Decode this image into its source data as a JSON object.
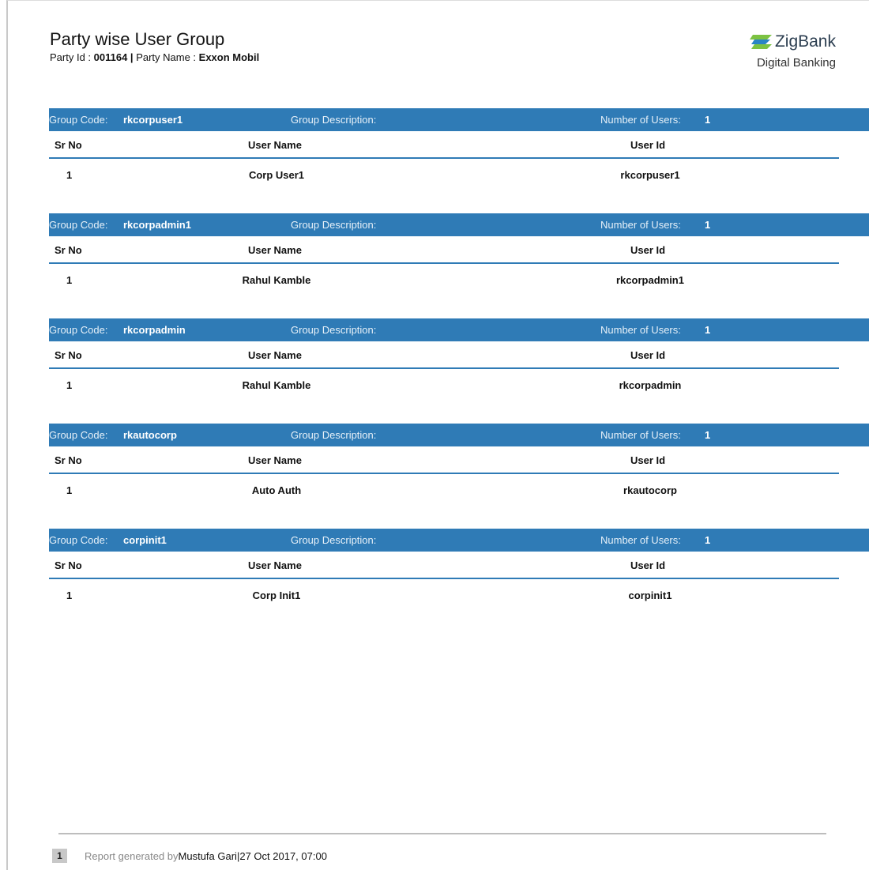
{
  "report": {
    "title": "Party wise User Group",
    "party_id_label": "Party Id : ",
    "party_id": "001164",
    "separator": " | ",
    "party_name_label": "Party Name : ",
    "party_name": "Exxon Mobil"
  },
  "brand": {
    "name": "ZigBank",
    "tagline": "Digital Banking",
    "icon": "zigbank-logo-icon",
    "colors": {
      "green": "#7cc242",
      "blue": "#2a84c6"
    }
  },
  "labels": {
    "group_code": "Group Code:",
    "group_description": "Group Description:",
    "number_of_users": "Number of Users:",
    "sr_no": "Sr No",
    "user_name": "User Name",
    "user_id": "User Id"
  },
  "colors": {
    "group_bar": "#2f7bb6"
  },
  "groups": [
    {
      "code": "rkcorpuser1",
      "description": "",
      "users_count": "1",
      "rows": [
        {
          "sr": "1",
          "name": "Corp User1",
          "id": "rkcorpuser1"
        }
      ]
    },
    {
      "code": "rkcorpadmin1",
      "description": "",
      "users_count": "1",
      "rows": [
        {
          "sr": "1",
          "name": "Rahul Kamble",
          "id": "rkcorpadmin1"
        }
      ]
    },
    {
      "code": "rkcorpadmin",
      "description": "",
      "users_count": "1",
      "rows": [
        {
          "sr": "1",
          "name": "Rahul Kamble",
          "id": "rkcorpadmin"
        }
      ]
    },
    {
      "code": "rkautocorp",
      "description": "",
      "users_count": "1",
      "rows": [
        {
          "sr": "1",
          "name": "Auto Auth",
          "id": "rkautocorp"
        }
      ]
    },
    {
      "code": "corpinit1",
      "description": "",
      "users_count": "1",
      "rows": [
        {
          "sr": "1",
          "name": "Corp Init1",
          "id": "corpinit1"
        }
      ]
    }
  ],
  "footer": {
    "page_number": "1",
    "generated_by_label": "Report generated by ",
    "generated_by": "Mustufa Gari",
    "separator": " | ",
    "timestamp": "27 Oct 2017, 07:00"
  }
}
